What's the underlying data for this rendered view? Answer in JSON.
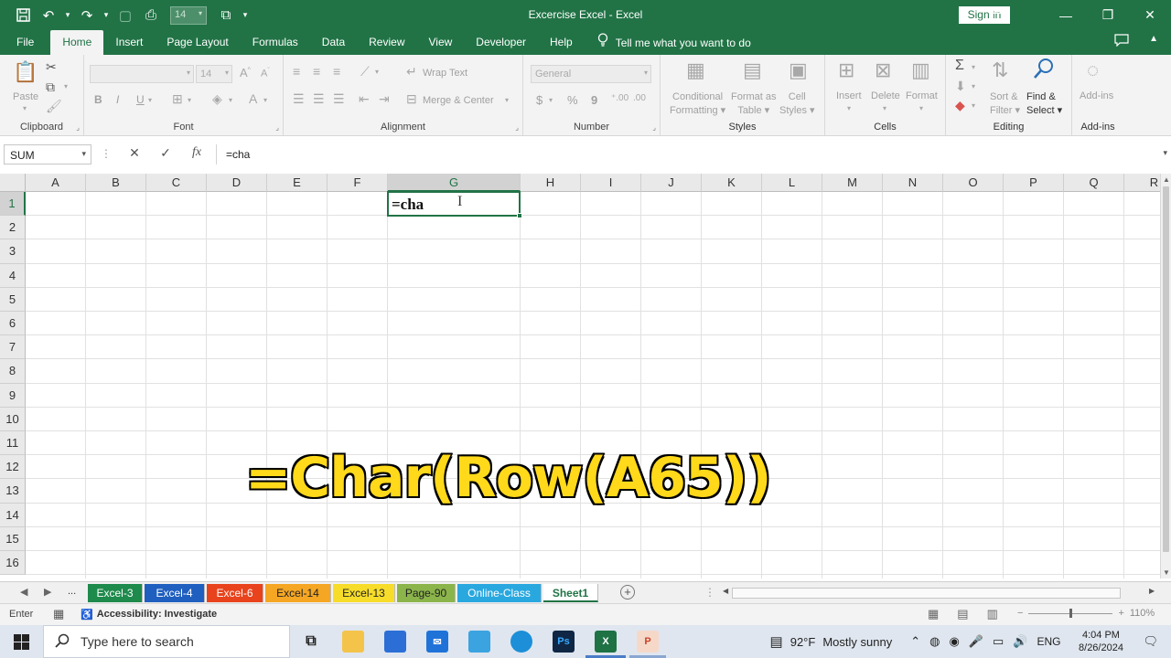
{
  "window": {
    "title": "Excercise Excel  -  Excel",
    "sign_in": "Sign in",
    "qat_font_size": "14"
  },
  "menu": {
    "tabs": [
      "File",
      "Home",
      "Insert",
      "Page Layout",
      "Formulas",
      "Data",
      "Review",
      "View",
      "Developer",
      "Help"
    ],
    "active_tab": "Home",
    "tell_me": "Tell me what you want to do"
  },
  "ribbon": {
    "clipboard": {
      "label": "Clipboard",
      "paste": "Paste"
    },
    "font": {
      "label": "Font",
      "size": "14",
      "bold": "B",
      "italic": "I",
      "underline": "U"
    },
    "alignment": {
      "label": "Alignment",
      "wrap_text": "Wrap Text",
      "merge_center": "Merge & Center"
    },
    "number": {
      "label": "Number",
      "format": "General",
      "currency": "$",
      "percent": "%",
      "comma": "9"
    },
    "styles": {
      "label": "Styles",
      "conditional_1": "Conditional",
      "conditional_2": "Formatting",
      "format_as_1": "Format as",
      "format_as_2": "Table",
      "cell_styles_1": "Cell",
      "cell_styles_2": "Styles"
    },
    "cells": {
      "label": "Cells",
      "insert": "Insert",
      "delete": "Delete",
      "format": "Format"
    },
    "editing": {
      "label": "Editing",
      "sort_1": "Sort &",
      "sort_2": "Filter",
      "find_1": "Find &",
      "find_2": "Select"
    },
    "addins": {
      "label": "Add-ins",
      "button": "Add-ins"
    }
  },
  "formula_bar": {
    "name_box": "SUM",
    "cancel": "✕",
    "enter": "✓",
    "fx": "fx",
    "value": "=cha"
  },
  "grid": {
    "columns": [
      "A",
      "B",
      "C",
      "D",
      "E",
      "F",
      "G",
      "H",
      "I",
      "J",
      "K",
      "L",
      "M",
      "N",
      "O",
      "P",
      "Q",
      "R"
    ],
    "rows": [
      "1",
      "2",
      "3",
      "4",
      "5",
      "6",
      "7",
      "8",
      "9",
      "10",
      "11",
      "12",
      "13",
      "14",
      "15",
      "16"
    ],
    "selected_column": "G",
    "selected_row": "1",
    "active_cell_text": "=cha",
    "cursor": "I"
  },
  "overlay_caption": "=Char(Row(A65))",
  "sheets": {
    "ellipsis": "...",
    "tabs": [
      {
        "name": "Excel-3",
        "color": "#1e8a4c",
        "text": "#ffffff"
      },
      {
        "name": "Excel-4",
        "color": "#1f5fbf",
        "text": "#ffffff"
      },
      {
        "name": "Excel-6",
        "color": "#e8431c",
        "text": "#ffffff"
      },
      {
        "name": "Excel-14",
        "color": "#f5a623",
        "text": "#222222"
      },
      {
        "name": "Excel-13",
        "color": "#f7dd2a",
        "text": "#222222"
      },
      {
        "name": "Page-90",
        "color": "#8bb54a",
        "text": "#222222"
      },
      {
        "name": "Online-Class",
        "color": "#29a8df",
        "text": "#ffffff"
      },
      {
        "name": "Sheet1",
        "color": "#ffffff",
        "text": "#217346"
      }
    ],
    "active": "Sheet1"
  },
  "status": {
    "mode": "Enter",
    "accessibility": "Accessibility: Investigate",
    "zoom": "110%"
  },
  "taskbar": {
    "search_placeholder": "Type here to search",
    "weather_temp": "92°F",
    "weather_text": "Mostly sunny",
    "lang": "ENG",
    "time": "4:04 PM",
    "date": "8/26/2024",
    "ps": "Ps"
  },
  "colors": {
    "excel_green": "#217346",
    "caption_yellow": "#ffd91a"
  }
}
